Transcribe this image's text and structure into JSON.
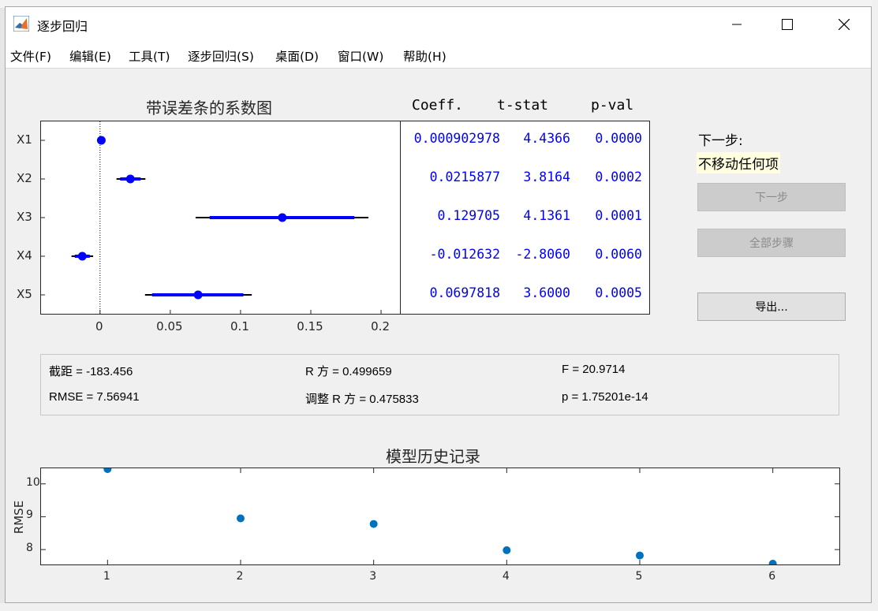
{
  "window": {
    "title": "逐步回归"
  },
  "menu": [
    "文件(F)",
    "编辑(E)",
    "工具(T)",
    "逐步回归(S)",
    "桌面(D)",
    "窗口(W)",
    "帮助(H)"
  ],
  "coef_plot": {
    "title": "带误差条的系数图",
    "ticks": [
      "0",
      "0.05",
      "0.1",
      "0.15",
      "0.2"
    ]
  },
  "coef_table": {
    "headers": [
      "Coeff.",
      "t-stat",
      "p-val"
    ],
    "rows": [
      {
        "coeff": "0.000902978",
        "tstat": "4.4366",
        "pval": "0.0000"
      },
      {
        "coeff": "0.0215877",
        "tstat": "3.8164",
        "pval": "0.0002"
      },
      {
        "coeff": "0.129705",
        "tstat": "4.1361",
        "pval": "0.0001"
      },
      {
        "coeff": "-0.012632",
        "tstat": "-2.8060",
        "pval": "0.0060"
      },
      {
        "coeff": "0.0697818",
        "tstat": "3.6000",
        "pval": "0.0005"
      }
    ]
  },
  "next_step": {
    "label": "下一步:",
    "value": "不移动任何项"
  },
  "buttons": {
    "next": "下一步",
    "all_steps": "全部步骤",
    "export": "导出..."
  },
  "stats": {
    "intercept": "截距 = -183.456",
    "rsq": "R 方 = 0.499659",
    "f": "F = 20.9714",
    "rmse": "RMSE = 7.56941",
    "adj_rsq": "调整 R 方 = 0.475833",
    "p": "p = 1.75201e-14"
  },
  "history": {
    "title": "模型历史记录",
    "ylabel": "RMSE"
  },
  "chart_data": [
    {
      "type": "scatter",
      "title": "带误差条的系数图",
      "categories": [
        "X1",
        "X2",
        "X3",
        "X4",
        "X5"
      ],
      "values": [
        0.000902978,
        0.0215877,
        0.129705,
        -0.012632,
        0.0697818
      ],
      "ci_inner": [
        [
          -0.0003,
          0.0021
        ],
        [
          0.0143,
          0.0289
        ],
        [
          0.078,
          0.181
        ],
        [
          -0.018,
          -0.0073
        ],
        [
          0.037,
          0.102
        ]
      ],
      "ci_outer": [
        [
          -0.0009,
          0.0027
        ],
        [
          0.0117,
          0.0323
        ],
        [
          0.068,
          0.191
        ],
        [
          -0.0203,
          -0.0049
        ],
        [
          0.032,
          0.108
        ]
      ],
      "xlim": [
        -0.042,
        0.214
      ],
      "xticks": [
        0,
        0.05,
        0.1,
        0.15,
        0.2
      ],
      "color": "#0000ff",
      "zero_line": "dotted"
    },
    {
      "type": "scatter",
      "title": "模型历史记录",
      "xlabel": "",
      "ylabel": "RMSE",
      "x": [
        1,
        2,
        3,
        4,
        5,
        6
      ],
      "y": [
        10.45,
        8.95,
        8.78,
        7.98,
        7.82,
        7.57
      ],
      "xlim": [
        0.5,
        6.5
      ],
      "ylim": [
        7.57,
        10.45
      ],
      "xticks": [
        1,
        2,
        3,
        4,
        5,
        6
      ],
      "yticks": [
        8,
        9,
        10
      ],
      "color": "#0072bd"
    }
  ]
}
